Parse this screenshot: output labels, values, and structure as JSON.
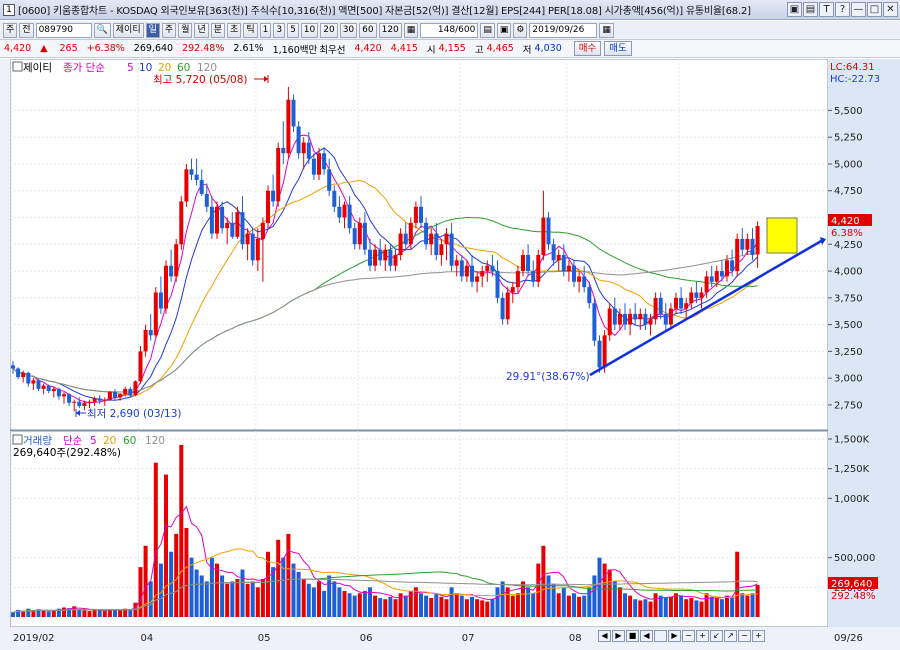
{
  "window": {
    "number": "1",
    "title": "[0600] 키움종합차트 - KOSDAQ 외국인보유[363(천)] 주식수[10,316(천)] 액면[500] 자본금[52(억)] 결산[12월] EPS[244] PER[18.08] 시가총액[456(억)] 유통비율[68.2]",
    "controls": [
      "▣",
      "▤",
      "T",
      "?",
      "—",
      "□",
      "✕"
    ]
  },
  "toolbar": {
    "mode": "주",
    "mode2": "전",
    "code": "089790",
    "name_button": "제이티",
    "periods": [
      "일",
      "주",
      "월",
      "년",
      "분",
      "초",
      "틱"
    ],
    "selected_period": "일",
    "intervals": [
      "1",
      "3",
      "5",
      "10",
      "20",
      "30",
      "60",
      "120"
    ],
    "count": "148/600",
    "date": "2019/09/26"
  },
  "quote": {
    "price": "4,420",
    "arrow": "▲",
    "change": "265",
    "change_pct": "+6.38%",
    "volume": "269,640",
    "volume_pct": "292.48%",
    "turnover": "2.61%",
    "amount": "1,160백만",
    "pref_label": "최우선",
    "ask": "4,420",
    "bid": "4,415",
    "open_label": "시",
    "open": "4,155",
    "high_label": "고",
    "high": "4,465",
    "low_label": "저",
    "low": "4,030",
    "buy_label": "매수",
    "sell_label": "매도"
  },
  "price_panel": {
    "legend": {
      "name": "제이티",
      "type": "종가 단순",
      "periods": [
        "5",
        "10",
        "20",
        "60",
        "120"
      ]
    },
    "axis_ticks": [
      "5,500",
      "5,250",
      "5,000",
      "4,750",
      "4,500",
      "4,250",
      "4,000",
      "3,750",
      "3,500",
      "3,250",
      "3,000",
      "2,750"
    ],
    "lc": "LC:64.31",
    "hc": "HC:-22.73",
    "current_price": "4,420",
    "current_pct": "6.38%",
    "high_note": "최고 5,720 (05/08)",
    "low_note": "최저 2,690 (03/13)",
    "trend_note": "29.91°(38.67%)"
  },
  "volume_panel": {
    "legend": {
      "name": "거래량",
      "type": "단순",
      "periods": [
        "5",
        "20",
        "60",
        "120"
      ]
    },
    "summary": "269,640주(292.48%)",
    "axis_ticks": [
      "1,500K",
      "1,250K",
      "1,000K",
      "500,000",
      "250,000"
    ],
    "current_volume": "269,640",
    "current_pct": "292.48%"
  },
  "x_axis": {
    "labels": [
      "2019/02",
      "04",
      "05",
      "06",
      "07",
      "08",
      "09"
    ],
    "end_label": "09/26"
  },
  "scroll_controls": [
    "◀",
    "▶",
    "■",
    "◀",
    "▶",
    "−",
    "+",
    "−",
    "+"
  ],
  "colors": {
    "up": "#e60000",
    "down": "#1f5fd6",
    "ma5": "#e000c8",
    "ma10": "#1f3bd6",
    "ma20": "#f0a000",
    "ma60": "#2aa02a",
    "ma120": "#909090",
    "trend": "#1030e0",
    "box": "#ffff00",
    "axis_bg": "#dbe7f5"
  },
  "chart_data": {
    "type": "candlestick",
    "price_axis": [
      2600,
      5700
    ],
    "volume_axis": [
      0,
      1500000
    ],
    "points": [
      [
        0,
        3120,
        3160,
        3040,
        3090,
        40000
      ],
      [
        1,
        3090,
        3100,
        2990,
        3010,
        60000
      ],
      [
        2,
        3010,
        3070,
        2960,
        3050,
        45000
      ],
      [
        3,
        3050,
        3060,
        2920,
        2950,
        70000
      ],
      [
        4,
        2950,
        3000,
        2890,
        2980,
        50000
      ],
      [
        5,
        2980,
        2990,
        2880,
        2900,
        65000
      ],
      [
        6,
        2900,
        2950,
        2850,
        2930,
        55000
      ],
      [
        7,
        2930,
        2940,
        2860,
        2880,
        48000
      ],
      [
        8,
        2880,
        2920,
        2820,
        2900,
        60000
      ],
      [
        9,
        2900,
        2910,
        2800,
        2830,
        70000
      ],
      [
        10,
        2830,
        2870,
        2760,
        2850,
        80000
      ],
      [
        11,
        2850,
        2860,
        2740,
        2770,
        75000
      ],
      [
        12,
        2770,
        2800,
        2690,
        2780,
        90000
      ],
      [
        13,
        2780,
        2820,
        2720,
        2740,
        60000
      ],
      [
        14,
        2740,
        2790,
        2700,
        2770,
        55000
      ],
      [
        15,
        2770,
        2800,
        2720,
        2780,
        50000
      ],
      [
        16,
        2780,
        2830,
        2740,
        2810,
        60000
      ],
      [
        17,
        2810,
        2840,
        2760,
        2790,
        58000
      ],
      [
        18,
        2790,
        2820,
        2740,
        2800,
        50000
      ],
      [
        19,
        2800,
        2880,
        2790,
        2870,
        65000
      ],
      [
        20,
        2870,
        2900,
        2800,
        2820,
        60000
      ],
      [
        21,
        2820,
        2860,
        2790,
        2850,
        55000
      ],
      [
        22,
        2850,
        2920,
        2830,
        2900,
        70000
      ],
      [
        23,
        2900,
        2920,
        2820,
        2840,
        60000
      ],
      [
        24,
        2840,
        2980,
        2830,
        2970,
        120000
      ],
      [
        25,
        2970,
        3300,
        2950,
        3250,
        420000
      ],
      [
        26,
        3250,
        3500,
        3200,
        3450,
        600000
      ],
      [
        27,
        3450,
        3600,
        3350,
        3400,
        300000
      ],
      [
        28,
        3400,
        3850,
        3380,
        3800,
        1300000
      ],
      [
        29,
        3800,
        3950,
        3600,
        3650,
        450000
      ],
      [
        30,
        3650,
        4100,
        3600,
        4050,
        1200000
      ],
      [
        31,
        4050,
        4200,
        3900,
        3950,
        550000
      ],
      [
        32,
        3950,
        4300,
        3900,
        4250,
        700000
      ],
      [
        33,
        4250,
        4700,
        4200,
        4650,
        1450000
      ],
      [
        34,
        4650,
        5000,
        4600,
        4950,
        750000
      ],
      [
        35,
        4950,
        5050,
        4850,
        4900,
        500000
      ],
      [
        36,
        4900,
        5050,
        4800,
        4850,
        400000
      ],
      [
        37,
        4850,
        4950,
        4700,
        4720,
        350000
      ],
      [
        38,
        4720,
        4820,
        4550,
        4600,
        300000
      ],
      [
        39,
        4600,
        4700,
        4300,
        4350,
        500000
      ],
      [
        40,
        4350,
        4650,
        4300,
        4600,
        450000
      ],
      [
        41,
        4600,
        4650,
        4350,
        4400,
        350000
      ],
      [
        42,
        4400,
        4500,
        4250,
        4450,
        280000
      ],
      [
        43,
        4450,
        4550,
        4300,
        4320,
        300000
      ],
      [
        44,
        4320,
        4600,
        4300,
        4550,
        320000
      ],
      [
        45,
        4550,
        4700,
        4200,
        4250,
        400000
      ],
      [
        46,
        4250,
        4400,
        4100,
        4350,
        280000
      ],
      [
        47,
        4350,
        4400,
        4050,
        4100,
        300000
      ],
      [
        48,
        4100,
        4400,
        4000,
        4300,
        250000
      ],
      [
        49,
        4300,
        4500,
        3900,
        4450,
        320000
      ],
      [
        50,
        4450,
        4800,
        4400,
        4750,
        550000
      ],
      [
        51,
        4750,
        4900,
        4600,
        4650,
        420000
      ],
      [
        52,
        4650,
        5200,
        4600,
        5150,
        650000
      ],
      [
        53,
        5150,
        5400,
        5000,
        5100,
        500000
      ],
      [
        54,
        5100,
        5720,
        5050,
        5600,
        700000
      ],
      [
        55,
        5600,
        5650,
        5300,
        5350,
        450000
      ],
      [
        56,
        5350,
        5400,
        5050,
        5100,
        380000
      ],
      [
        57,
        5100,
        5250,
        4950,
        5200,
        320000
      ],
      [
        58,
        5200,
        5300,
        5000,
        5050,
        280000
      ],
      [
        59,
        5050,
        5100,
        4850,
        4900,
        250000
      ],
      [
        60,
        4900,
        5150,
        4850,
        5100,
        300000
      ],
      [
        61,
        5100,
        5150,
        4900,
        4950,
        220000
      ],
      [
        62,
        4950,
        5050,
        4700,
        4750,
        350000
      ],
      [
        63,
        4750,
        4800,
        4550,
        4600,
        300000
      ],
      [
        64,
        4600,
        4700,
        4450,
        4500,
        250000
      ],
      [
        65,
        4500,
        4650,
        4400,
        4620,
        220000
      ],
      [
        66,
        4620,
        4700,
        4350,
        4400,
        200000
      ],
      [
        67,
        4400,
        4450,
        4200,
        4250,
        180000
      ],
      [
        68,
        4250,
        4500,
        4200,
        4450,
        200000
      ],
      [
        69,
        4450,
        4550,
        4150,
        4200,
        220000
      ],
      [
        70,
        4200,
        4300,
        4000,
        4050,
        250000
      ],
      [
        71,
        4050,
        4250,
        4000,
        4200,
        180000
      ],
      [
        72,
        4200,
        4300,
        4050,
        4100,
        160000
      ],
      [
        73,
        4100,
        4250,
        4000,
        4200,
        150000
      ],
      [
        74,
        4200,
        4250,
        4000,
        4050,
        170000
      ],
      [
        75,
        4050,
        4200,
        4000,
        4150,
        150000
      ],
      [
        76,
        4150,
        4400,
        4100,
        4350,
        200000
      ],
      [
        77,
        4350,
        4450,
        4200,
        4250,
        180000
      ],
      [
        78,
        4250,
        4500,
        4200,
        4450,
        220000
      ],
      [
        79,
        4450,
        4650,
        4400,
        4600,
        250000
      ],
      [
        80,
        4600,
        4700,
        4400,
        4450,
        200000
      ],
      [
        81,
        4450,
        4500,
        4200,
        4250,
        180000
      ],
      [
        82,
        4250,
        4400,
        4150,
        4350,
        160000
      ],
      [
        83,
        4350,
        4450,
        4100,
        4150,
        200000
      ],
      [
        84,
        4150,
        4300,
        4050,
        4250,
        170000
      ],
      [
        85,
        4250,
        4400,
        4100,
        4350,
        150000
      ],
      [
        86,
        4350,
        4450,
        4000,
        4050,
        250000
      ],
      [
        87,
        4050,
        4150,
        3950,
        4100,
        200000
      ],
      [
        88,
        4100,
        4150,
        3900,
        3950,
        180000
      ],
      [
        89,
        3950,
        4100,
        3900,
        4050,
        150000
      ],
      [
        90,
        4050,
        4150,
        3850,
        3900,
        170000
      ],
      [
        91,
        3900,
        4000,
        3800,
        3950,
        150000
      ],
      [
        92,
        3950,
        4050,
        3850,
        4000,
        140000
      ],
      [
        93,
        4000,
        4100,
        3900,
        4050,
        130000
      ],
      [
        94,
        4050,
        4150,
        3950,
        4000,
        150000
      ],
      [
        95,
        4000,
        4100,
        3700,
        3750,
        250000
      ],
      [
        96,
        3750,
        3800,
        3500,
        3550,
        300000
      ],
      [
        97,
        3550,
        3850,
        3500,
        3800,
        250000
      ],
      [
        98,
        3800,
        3900,
        3700,
        3850,
        180000
      ],
      [
        99,
        3850,
        4050,
        3800,
        4000,
        200000
      ],
      [
        100,
        4000,
        4200,
        3950,
        4150,
        300000
      ],
      [
        101,
        4150,
        4250,
        3950,
        4000,
        250000
      ],
      [
        102,
        4000,
        4100,
        3850,
        3900,
        200000
      ],
      [
        103,
        3900,
        4200,
        3850,
        4150,
        450000
      ],
      [
        104,
        4150,
        4750,
        4100,
        4500,
        600000
      ],
      [
        105,
        4500,
        4550,
        4200,
        4250,
        350000
      ],
      [
        106,
        4250,
        4300,
        4050,
        4100,
        280000
      ],
      [
        107,
        4100,
        4200,
        4000,
        4150,
        200000
      ],
      [
        108,
        4150,
        4250,
        3950,
        4000,
        250000
      ],
      [
        109,
        4000,
        4100,
        3900,
        4050,
        180000
      ],
      [
        110,
        4050,
        4100,
        3850,
        3900,
        200000
      ],
      [
        111,
        3900,
        4000,
        3800,
        3950,
        170000
      ],
      [
        112,
        3950,
        4050,
        3800,
        3850,
        180000
      ],
      [
        113,
        3850,
        3900,
        3650,
        3700,
        250000
      ],
      [
        114,
        3700,
        3750,
        3300,
        3350,
        350000
      ],
      [
        115,
        3350,
        3400,
        3050,
        3100,
        500000
      ],
      [
        116,
        3100,
        3450,
        3050,
        3400,
        450000
      ],
      [
        117,
        3400,
        3700,
        3350,
        3650,
        400000
      ],
      [
        118,
        3650,
        3750,
        3450,
        3500,
        300000
      ],
      [
        119,
        3500,
        3650,
        3450,
        3600,
        250000
      ],
      [
        120,
        3600,
        3700,
        3450,
        3500,
        200000
      ],
      [
        121,
        3500,
        3650,
        3400,
        3600,
        180000
      ],
      [
        122,
        3600,
        3700,
        3500,
        3550,
        150000
      ],
      [
        123,
        3550,
        3650,
        3450,
        3600,
        140000
      ],
      [
        124,
        3600,
        3650,
        3450,
        3500,
        150000
      ],
      [
        125,
        3500,
        3600,
        3400,
        3550,
        130000
      ],
      [
        126,
        3550,
        3800,
        3500,
        3750,
        200000
      ],
      [
        127,
        3750,
        3800,
        3550,
        3600,
        180000
      ],
      [
        128,
        3600,
        3700,
        3450,
        3500,
        160000
      ],
      [
        129,
        3500,
        3700,
        3450,
        3650,
        170000
      ],
      [
        130,
        3650,
        3800,
        3600,
        3750,
        200000
      ],
      [
        131,
        3750,
        3850,
        3600,
        3650,
        180000
      ],
      [
        132,
        3650,
        3750,
        3550,
        3700,
        150000
      ],
      [
        133,
        3700,
        3850,
        3650,
        3800,
        160000
      ],
      [
        134,
        3800,
        3900,
        3700,
        3750,
        140000
      ],
      [
        135,
        3750,
        3850,
        3650,
        3800,
        130000
      ],
      [
        136,
        3800,
        4000,
        3750,
        3950,
        200000
      ],
      [
        137,
        3950,
        4050,
        3850,
        3900,
        170000
      ],
      [
        138,
        3900,
        4050,
        3850,
        4000,
        160000
      ],
      [
        139,
        4000,
        4100,
        3900,
        3950,
        150000
      ],
      [
        140,
        3950,
        4150,
        3900,
        4100,
        180000
      ],
      [
        141,
        4100,
        4200,
        3950,
        4000,
        170000
      ],
      [
        142,
        4000,
        4350,
        3950,
        4300,
        550000
      ],
      [
        143,
        4300,
        4400,
        4150,
        4200,
        200000
      ],
      [
        144,
        4200,
        4350,
        4150,
        4300,
        180000
      ],
      [
        145,
        4300,
        4400,
        4100,
        4150,
        200000
      ],
      [
        146,
        4155,
        4465,
        4030,
        4420,
        269640
      ]
    ]
  }
}
